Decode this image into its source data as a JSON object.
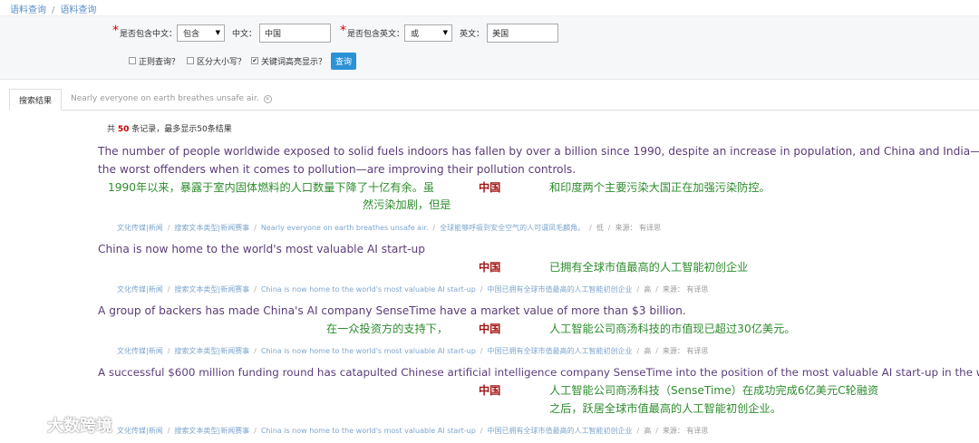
{
  "breadcrumb": [
    "语料查询",
    "语料查询"
  ],
  "form": {
    "include_cn_label": "是否包含中文：",
    "include_cn_value": "包含",
    "cn_label": "中文：",
    "cn_value": "中国",
    "include_en_label": "是否包含英文：",
    "include_en_value": "或",
    "en_label": "英文：",
    "en_value": "美国",
    "regex_label": "正则查询？",
    "case_label": "区分大小写？",
    "highlight_label": "关键词高亮显示？",
    "search_button": "查询"
  },
  "tabs": [
    {
      "label": "搜索结果"
    },
    {
      "label": "Nearly everyone on earth breathes unsafe air."
    }
  ],
  "summary": {
    "prefix": "共",
    "count": "50",
    "suffix": "条记录，最多显示50条结果"
  },
  "results": [
    {
      "en1": "The number of people worldwide exposed to solid fuels indoors has fallen by over a billion since 1990, despite an increase in population, and China and India—two of",
      "en2": "the worst offenders when it comes to pollution—are improving their pollution controls.",
      "cn_left1": "1990年以来，暴露于室内固体燃料的人口数量下降了十亿有余。虽",
      "cn_left2": "然污染加剧，但是",
      "keyword": "中国",
      "cn_right": "和印度两个主要污染大国正在加强污染防控。",
      "meta": [
        "文化传媒|新闻",
        "搜索文本类型|新闻赛事",
        "Nearly everyone on earth breathes unsafe air.",
        "全球能够呼吸到安全空气的人可谓凤毛麟角。",
        "低",
        "来源：  有译思"
      ]
    },
    {
      "en1": "China is now home to the world's most valuable AI start-up",
      "keyword": "中国",
      "cn_right": "已拥有全球市值最高的人工智能初创企业",
      "meta": [
        "文化传媒|新闻",
        "搜索文本类型|新闻赛事",
        "China is now home to the world's most valuable AI start-up",
        "中国已拥有全球市值最高的人工智能初创企业",
        "高",
        "来源：  有译思"
      ]
    },
    {
      "en1": "A group of backers has made China's AI company SenseTime have a market value of more than $3 billion.",
      "cn_left1": "在一众投资方的支持下，",
      "keyword": "中国",
      "cn_right": "人工智能公司商汤科技的市值现已超过30亿美元。",
      "meta": [
        "文化传媒|新闻",
        "搜索文本类型|新闻赛事",
        "China is now home to the world's most valuable AI start-up",
        "中国已拥有全球市值最高的人工智能初创企业",
        "高",
        "来源：  有译思"
      ]
    },
    {
      "en1": "A successful $600 million funding round has catapulted Chinese artificial intelligence company SenseTime into the position of the most valuable AI start-up in the world.",
      "keyword": "中国",
      "cn_right": "人工智能公司商汤科技（SenseTime）在成功完成6亿美元C轮融资",
      "cn_right2": "之后，跃居全球市值最高的人工智能初创企业。",
      "meta": [
        "文化传媒|新闻",
        "搜索文本类型|新闻赛事",
        "China is now home to the world's most valuable AI start-up",
        "中国已拥有全球市值最高的人工智能初创企业",
        "高",
        "来源：  有译思"
      ]
    }
  ],
  "watermark": "大数跨境"
}
